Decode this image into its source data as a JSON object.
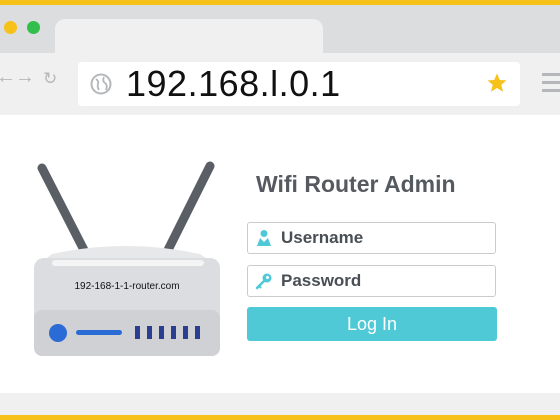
{
  "browser": {
    "url": "192.168.l.0.1",
    "nav": {
      "back": "←",
      "forward": "→",
      "reload": "↻"
    }
  },
  "router": {
    "label": "192-168-1-1-router.com"
  },
  "login": {
    "title": "Wifi Router Admin",
    "username_placeholder": "Username",
    "password_placeholder": "Password",
    "submit_label": "Log In"
  },
  "colors": {
    "frame": "#f6c21a",
    "accent": "#4fc9d6",
    "router_body": "#dcdde0",
    "router_blue": "#2a6bd6"
  },
  "icons": [
    "globe-icon",
    "star-icon",
    "menu-icon",
    "user-icon",
    "key-icon"
  ]
}
